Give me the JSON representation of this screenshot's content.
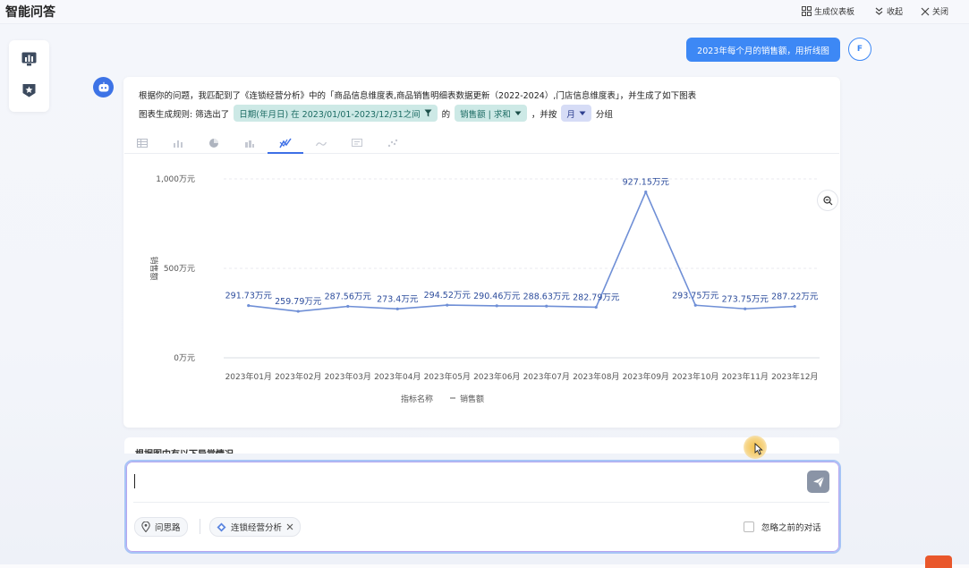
{
  "header": {
    "title": "智能问答",
    "dashboard_label": "生成仪表板",
    "collapse_label": "收起",
    "close_label": "关闭"
  },
  "user": {
    "question": "2023年每个月的销售额，用折线图",
    "avatar_letter": "F"
  },
  "answer": {
    "line1": "根据你的问题，我匹配到了《连锁经营分析》中的「商品信息维度表,商品销售明细表数据更新（2022-2024）,门店信息维度表」，并生成了如下图表",
    "rule_prefix": "图表生成规则: 筛选出了",
    "filter_chip": "日期(年月日) 在 2023/01/01-2023/12/31之间",
    "of_text": "的",
    "measure_chip": "销售额 | 求和",
    "group_prefix": "，并按",
    "group_chip": "月",
    "group_suffix": "分组"
  },
  "chart_tabs": [
    "table",
    "bar",
    "pie",
    "stacked-bar",
    "line",
    "area",
    "card",
    "scatter"
  ],
  "chart_data": {
    "type": "line",
    "categories": [
      "2023年01月",
      "2023年02月",
      "2023年03月",
      "2023年04月",
      "2023年05月",
      "2023年06月",
      "2023年07月",
      "2023年08月",
      "2023年09月",
      "2023年10月",
      "2023年11月",
      "2023年12月"
    ],
    "values": [
      291.73,
      259.79,
      287.56,
      273.4,
      294.52,
      290.46,
      288.63,
      282.79,
      927.15,
      293.75,
      273.75,
      287.22
    ],
    "data_labels": [
      "291.73万元",
      "259.79万元",
      "287.56万元",
      "273.4万元",
      "294.52万元",
      "290.46万元",
      "288.63万元",
      "282.79万元",
      "927.15万元",
      "293.75万元",
      "273.75万元",
      "287.22万元"
    ],
    "yticks": [
      0,
      500,
      1000
    ],
    "ytick_labels": [
      "0万元",
      "500万元",
      "1,000万元"
    ],
    "ylim": [
      0,
      1000
    ],
    "ylabel": "销售额",
    "legend_title": "指标名称",
    "series": [
      {
        "name": "销售额",
        "color": "#6f8fd6"
      }
    ]
  },
  "peek_text": "根据图中有以下异常情况",
  "input": {
    "value": "",
    "chip_thinking": "问思路",
    "chip_dataset": "连锁经营分析",
    "ignore_label": "忽略之前的对话"
  },
  "colors": {
    "accent": "#3d88f5",
    "line": "#6f8fd6",
    "filter_chip_bg": "#cde9e6",
    "measure_chip_bg": "#d6dcf6"
  }
}
